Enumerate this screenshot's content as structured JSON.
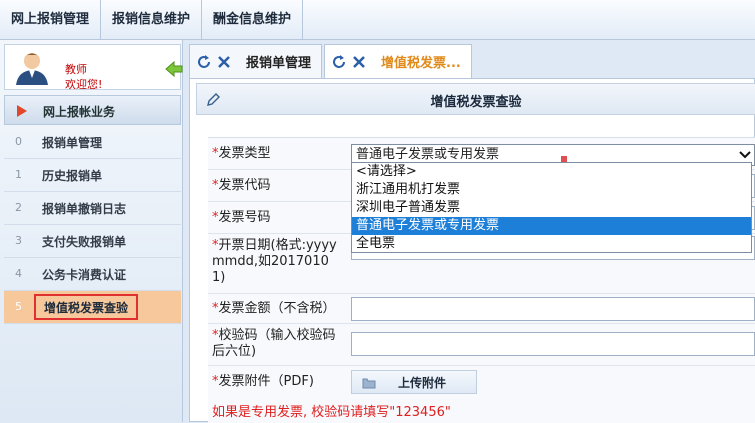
{
  "top_menu": [
    "网上报销管理",
    "报销信息维护",
    "酬金信息维护"
  ],
  "user": {
    "name": "教师",
    "welcome": "欢迎您!"
  },
  "sidebar": {
    "section_title": "网上报帐业务",
    "items": [
      {
        "num": "0",
        "label": "报销单管理"
      },
      {
        "num": "1",
        "label": "历史报销单"
      },
      {
        "num": "2",
        "label": "报销单撤销日志"
      },
      {
        "num": "3",
        "label": "支付失败报销单"
      },
      {
        "num": "4",
        "label": "公务卡消费认证"
      },
      {
        "num": "5",
        "label": "增值税发票查验"
      }
    ]
  },
  "tabs": [
    {
      "label": "报销单管理",
      "active": false
    },
    {
      "label": "增值税发票...",
      "active": true
    }
  ],
  "panel": {
    "title": "增值税发票查验"
  },
  "form": {
    "invoice_type_label": "发票类型",
    "invoice_type_value": "普通电子发票或专用发票",
    "invoice_type_options": [
      "<请选择>",
      "浙江通用机打发票",
      "深圳电子普通发票",
      "普通电子发票或专用发票",
      "全电票"
    ],
    "invoice_code_label": "发票代码",
    "invoice_number_label": "发票号码",
    "issue_date_label": "开票日期(格式:yyyymmdd,如20170101)",
    "amount_label": "发票金额（不含税）",
    "check_code_label": "校验码（输入校验码后六位)",
    "attachment_label": "发票附件（PDF)",
    "upload_label": "上传附件",
    "hint": "如果是专用发票, 校验码请填写\"123456\""
  },
  "colors": {
    "active_nav": "#f7c89b",
    "active_tab_text": "#e08a1a",
    "highlight": "#1e7fd8",
    "required": "#e02020"
  }
}
